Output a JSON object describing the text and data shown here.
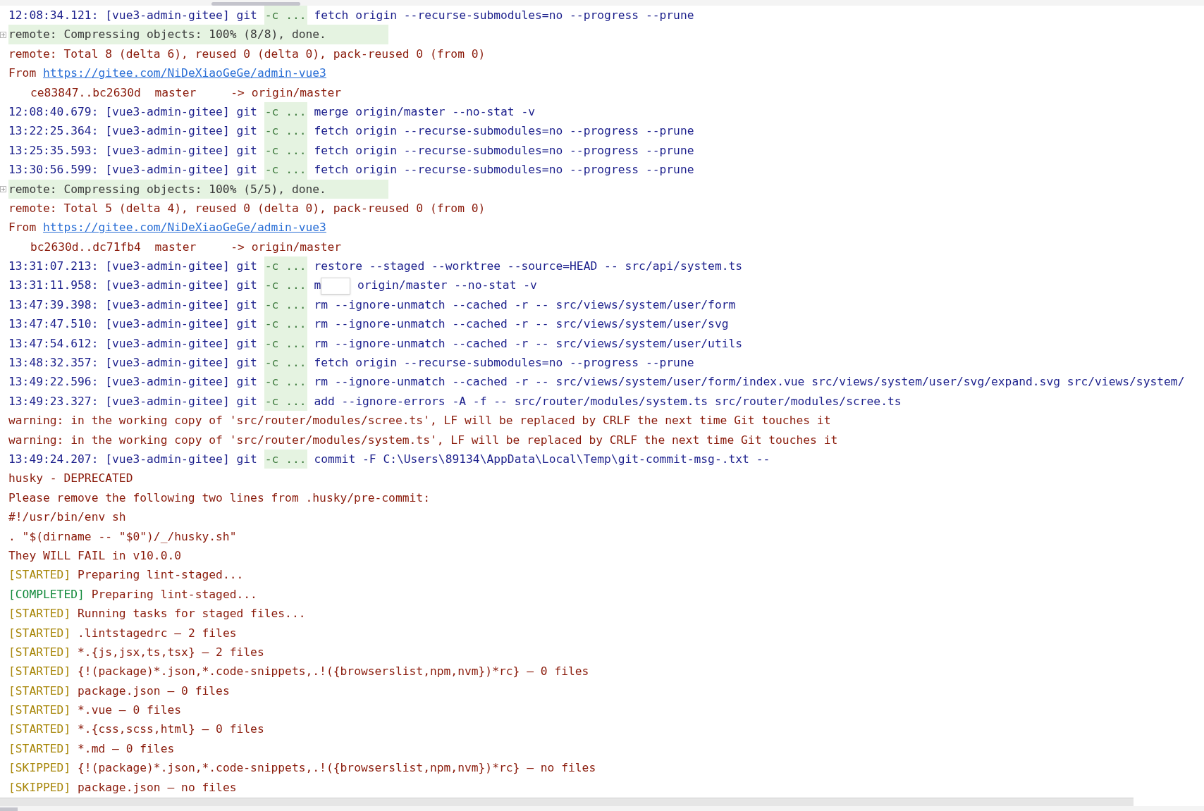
{
  "log": [
    {
      "kind": "git",
      "time": "12:08:34.121:",
      "repo": "[vue3-admin-gitee]",
      "program": "git",
      "flag": "-c ...",
      "command": "fetch origin --recurse-submodules=no --progress --prune"
    },
    {
      "kind": "progress",
      "text": "remote: Compressing objects: 100% (8/8), done."
    },
    {
      "kind": "output",
      "text": "remote: Total 8 (delta 6), reused 0 (delta 0), pack-reused 0 (from 0)"
    },
    {
      "kind": "from",
      "label": "From",
      "url": "https://gitee.com/NiDeXiaoGeGe/admin-vue3"
    },
    {
      "kind": "ref",
      "text": "ce83847..bc2630d  master     -> origin/master"
    },
    {
      "kind": "git",
      "time": "12:08:40.679:",
      "repo": "[vue3-admin-gitee]",
      "program": "git",
      "flag": "-c ...",
      "command": "merge origin/master --no-stat -v"
    },
    {
      "kind": "git",
      "time": "13:22:25.364:",
      "repo": "[vue3-admin-gitee]",
      "program": "git",
      "flag": "-c ...",
      "command": "fetch origin --recurse-submodules=no --progress --prune"
    },
    {
      "kind": "git",
      "time": "13:25:35.593:",
      "repo": "[vue3-admin-gitee]",
      "program": "git",
      "flag": "-c ...",
      "command": "fetch origin --recurse-submodules=no --progress --prune"
    },
    {
      "kind": "git",
      "time": "13:30:56.599:",
      "repo": "[vue3-admin-gitee]",
      "program": "git",
      "flag": "-c ...",
      "command": "fetch origin --recurse-submodules=no --progress --prune"
    },
    {
      "kind": "progress",
      "text": "remote: Compressing objects: 100% (5/5), done."
    },
    {
      "kind": "output",
      "text": "remote: Total 5 (delta 4), reused 0 (delta 0), pack-reused 0 (from 0)"
    },
    {
      "kind": "from",
      "label": "From",
      "url": "https://gitee.com/NiDeXiaoGeGe/admin-vue3"
    },
    {
      "kind": "ref",
      "text": "bc2630d..dc71fb4  master     -> origin/master"
    },
    {
      "kind": "git",
      "time": "13:31:07.213:",
      "repo": "[vue3-admin-gitee]",
      "program": "git",
      "flag": "-c ...",
      "command": "restore --staged --worktree --source=HEAD -- src/api/system.ts"
    },
    {
      "kind": "git",
      "time": "13:31:11.958:",
      "repo": "[vue3-admin-gitee]",
      "program": "git",
      "flag": "-c ...",
      "command": "m",
      "command_tail": "origin/master --no-stat -v"
    },
    {
      "kind": "git",
      "time": "13:47:39.398:",
      "repo": "[vue3-admin-gitee]",
      "program": "git",
      "flag": "-c ...",
      "command": "rm --ignore-unmatch --cached -r -- src/views/system/user/form"
    },
    {
      "kind": "git",
      "time": "13:47:47.510:",
      "repo": "[vue3-admin-gitee]",
      "program": "git",
      "flag": "-c ...",
      "command": "rm --ignore-unmatch --cached -r -- src/views/system/user/svg"
    },
    {
      "kind": "git",
      "time": "13:47:54.612:",
      "repo": "[vue3-admin-gitee]",
      "program": "git",
      "flag": "-c ...",
      "command": "rm --ignore-unmatch --cached -r -- src/views/system/user/utils"
    },
    {
      "kind": "git",
      "time": "13:48:32.357:",
      "repo": "[vue3-admin-gitee]",
      "program": "git",
      "flag": "-c ...",
      "command": "fetch origin --recurse-submodules=no --progress --prune"
    },
    {
      "kind": "git",
      "time": "13:49:22.596:",
      "repo": "[vue3-admin-gitee]",
      "program": "git",
      "flag": "-c ...",
      "command": "rm --ignore-unmatch --cached -r -- src/views/system/user/form/index.vue src/views/system/user/svg/expand.svg src/views/system/"
    },
    {
      "kind": "git",
      "time": "13:49:23.327:",
      "repo": "[vue3-admin-gitee]",
      "program": "git",
      "flag": "-c ...",
      "command": "add --ignore-errors -A -f -- src/router/modules/system.ts src/router/modules/scree.ts"
    },
    {
      "kind": "output",
      "text": "warning: in the working copy of 'src/router/modules/scree.ts', LF will be replaced by CRLF the next time Git touches it"
    },
    {
      "kind": "output",
      "text": "warning: in the working copy of 'src/router/modules/system.ts', LF will be replaced by CRLF the next time Git touches it"
    },
    {
      "kind": "git",
      "time": "13:49:24.207:",
      "repo": "[vue3-admin-gitee]",
      "program": "git",
      "flag": "-c ...",
      "command": "commit -F C:\\Users\\89134\\AppData\\Local\\Temp\\git-commit-msg-.txt --"
    },
    {
      "kind": "output",
      "text": "husky - DEPRECATED"
    },
    {
      "kind": "output",
      "text": "Please remove the following two lines from .husky/pre-commit:"
    },
    {
      "kind": "output",
      "text": "#!/usr/bin/env sh"
    },
    {
      "kind": "output",
      "text": ". \"$(dirname -- \"$0\")/_/husky.sh\""
    },
    {
      "kind": "output",
      "text": "They WILL FAIL in v10.0.0"
    },
    {
      "kind": "status",
      "tag": "[STARTED]",
      "color": "#a8870a",
      "text": "Preparing lint-staged..."
    },
    {
      "kind": "status",
      "tag": "[COMPLETED]",
      "color": "#138a3c",
      "text": "Preparing lint-staged..."
    },
    {
      "kind": "status",
      "tag": "[STARTED]",
      "color": "#a8870a",
      "text": "Running tasks for staged files..."
    },
    {
      "kind": "status",
      "tag": "[STARTED]",
      "color": "#a8870a",
      "text": ".lintstagedrc — 2 files"
    },
    {
      "kind": "status",
      "tag": "[STARTED]",
      "color": "#a8870a",
      "text": "*.{js,jsx,ts,tsx} — 2 files"
    },
    {
      "kind": "status",
      "tag": "[STARTED]",
      "color": "#a8870a",
      "text": "{!(package)*.json,*.code-snippets,.!({browserslist,npm,nvm})*rc} — 0 files"
    },
    {
      "kind": "status",
      "tag": "[STARTED]",
      "color": "#a8870a",
      "text": "package.json — 0 files"
    },
    {
      "kind": "status",
      "tag": "[STARTED]",
      "color": "#a8870a",
      "text": "*.vue — 0 files"
    },
    {
      "kind": "status",
      "tag": "[STARTED]",
      "color": "#a8870a",
      "text": "*.{css,scss,html} — 0 files"
    },
    {
      "kind": "status",
      "tag": "[STARTED]",
      "color": "#a8870a",
      "text": "*.md — 0 files"
    },
    {
      "kind": "status",
      "tag": "[SKIPPED]",
      "color": "#a8870a",
      "text": "{!(package)*.json,*.code-snippets,.!({browserslist,npm,nvm})*rc} — no files"
    },
    {
      "kind": "status",
      "tag": "[SKIPPED]",
      "color": "#a8870a",
      "text": "package.json — no files"
    }
  ]
}
